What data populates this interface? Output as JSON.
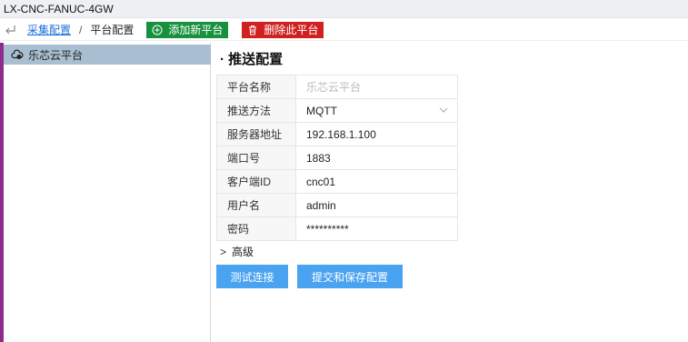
{
  "window": {
    "title": "LX-CNC-FANUC-4GW"
  },
  "breadcrumb": {
    "link": "采集配置",
    "separator": "/",
    "current": "平台配置"
  },
  "toolbar": {
    "add_label": "添加新平台",
    "delete_label": "删除此平台"
  },
  "sidebar": {
    "items": [
      {
        "label": "乐芯云平台",
        "icon": "cloud-icon"
      }
    ]
  },
  "main": {
    "section_title": "· 推送配置",
    "fields": [
      {
        "label": "平台名称",
        "value": "乐芯云平台"
      },
      {
        "label": "推送方法",
        "value": "MQTT"
      },
      {
        "label": "服务器地址",
        "value": "192.168.1.100"
      },
      {
        "label": "端口号",
        "value": "1883"
      },
      {
        "label": "客户端ID",
        "value": "cnc01"
      },
      {
        "label": "用户名",
        "value": "admin"
      },
      {
        "label": "密码",
        "value": "**********"
      }
    ],
    "advanced_label": "高级",
    "advanced_arrow": ">",
    "test_button": "测试连接",
    "submit_button": "提交和保存配置"
  },
  "colors": {
    "add": "#18913e",
    "delete": "#d0201f",
    "primary": "#4aa3f0",
    "sidebar_selected": "#a9bed1"
  }
}
